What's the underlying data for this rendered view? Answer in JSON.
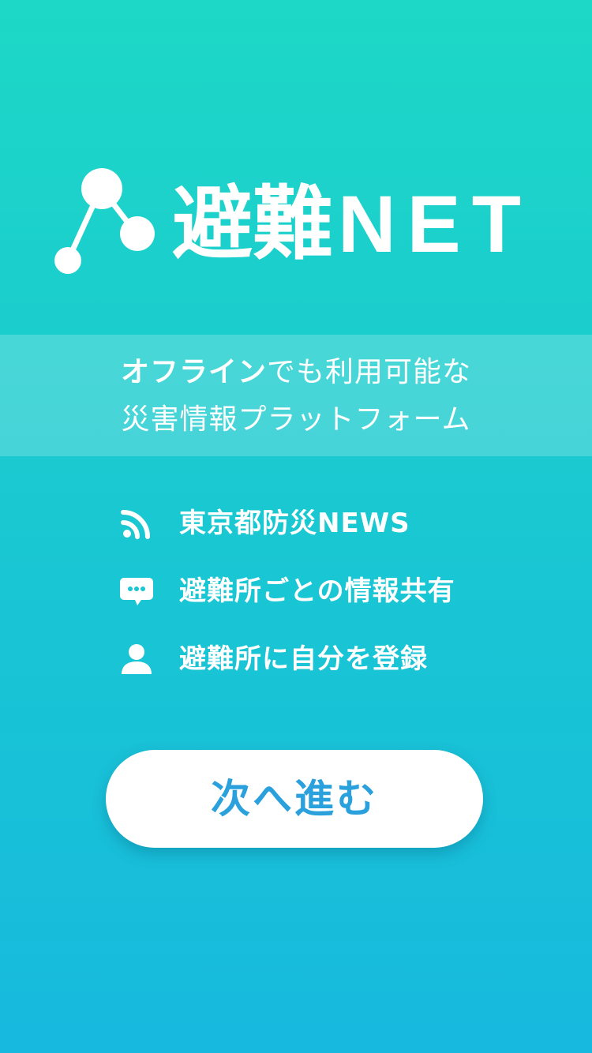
{
  "app": {
    "name_part1": "避難",
    "name_part2": "NET",
    "logo_icon": "network-nodes-icon"
  },
  "tagline": {
    "line1_bold": "オフライン",
    "line1_rest": "でも利用可能な",
    "line2": "災害情報プラットフォーム"
  },
  "features": [
    {
      "icon": "rss-icon",
      "label": "東京都防災NEWS"
    },
    {
      "icon": "chat-bubble-icon",
      "label": "避難所ごとの情報共有"
    },
    {
      "icon": "person-icon",
      "label": "避難所に自分を登録"
    }
  ],
  "next_button": {
    "label": "次へ進む"
  },
  "colors": {
    "background_top": "#1dd8c6",
    "background_bottom": "#17b9de",
    "button_text": "#2aa0dc",
    "foreground": "#ffffff"
  }
}
